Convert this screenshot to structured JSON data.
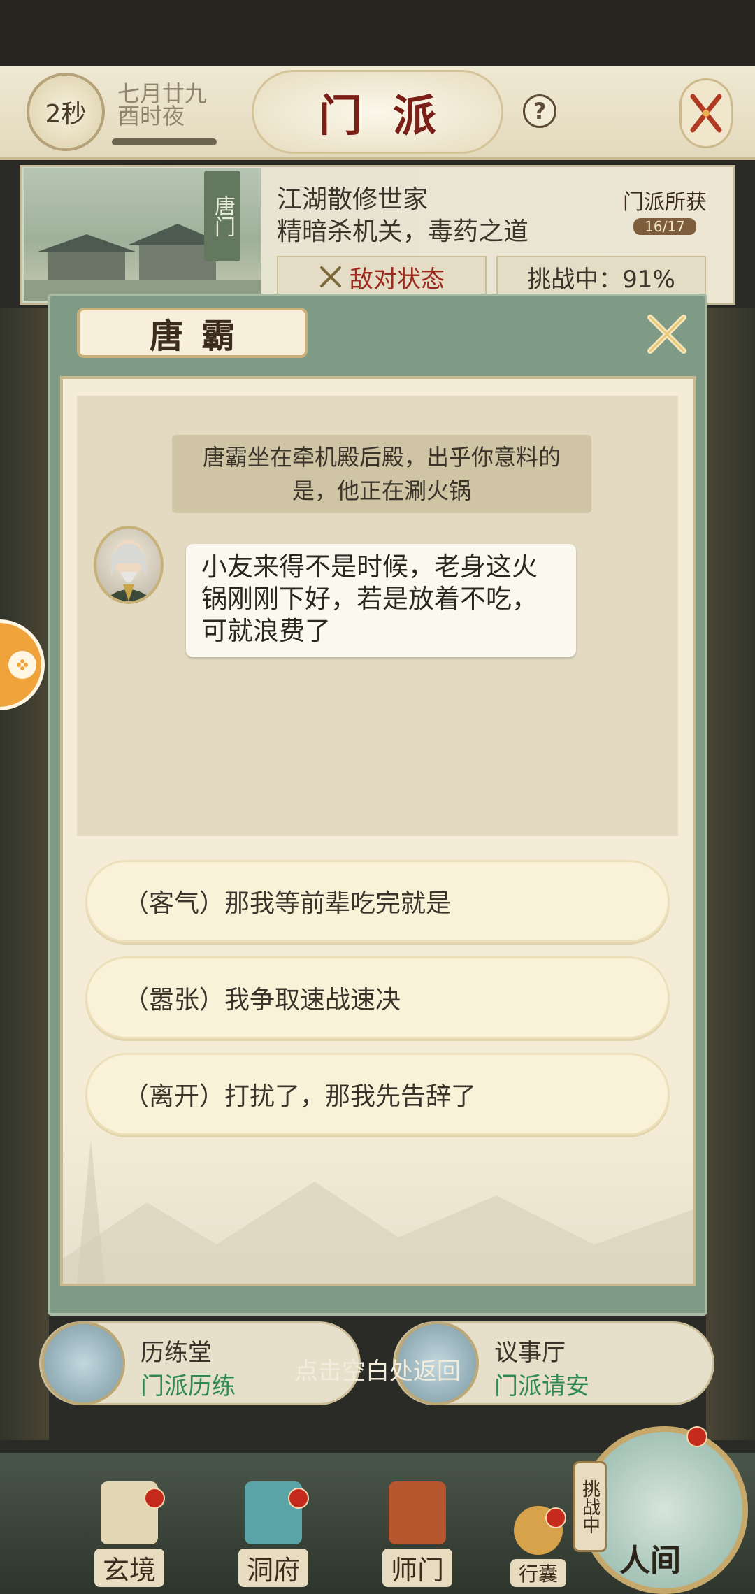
{
  "header": {
    "timer": "2秒",
    "date_line1": "七月廿九",
    "date_line2": "酉时夜",
    "title": "门派",
    "help_label": "?"
  },
  "sect": {
    "banner": "唐门",
    "desc_line1": "江湖散修世家",
    "desc_line2": "精暗杀机关，毒药之道",
    "reward_label": "门派所获",
    "reward_count": "16/17",
    "hostile_label": "敌对状态",
    "challenge_label": "挑战中：91%"
  },
  "dialog": {
    "npc_name": "唐霸",
    "narration": "唐霸坐在牵机殿后殿，出乎你意料的是，他正在涮火锅",
    "speech": "小友来得不是时候，老身这火锅刚刚下好，若是放着不吃，可就浪费了",
    "options": [
      "（客气）那我等前辈吃完就是",
      "（嚣张）我争取速战速决",
      "（离开）打扰了，那我先告辞了"
    ]
  },
  "entries": [
    {
      "name": "历练堂",
      "sub": "门派历练"
    },
    {
      "name": "议事厅",
      "sub": "门派请安"
    }
  ],
  "return_hint": "点击空白处返回",
  "nav": {
    "items": [
      "玄境",
      "洞府",
      "师门",
      "行囊"
    ],
    "renjian_tag": "挑战中",
    "renjian_label": "人间"
  },
  "colors": {
    "title_red": "#7a1e18",
    "dialog_green": "#7f9b85",
    "option_bg": "#f9f1d8",
    "hostile_red": "#9b2a1f",
    "sub_green": "#2e8a52"
  }
}
